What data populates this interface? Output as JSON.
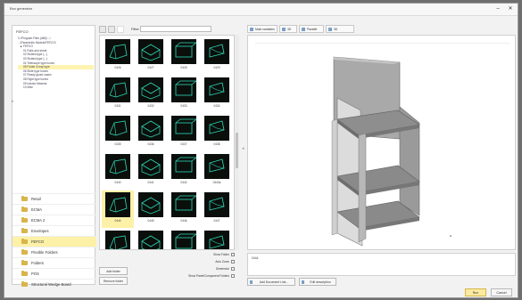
{
  "window": {
    "title": "Box generator",
    "min_glyph": "–",
    "close_glyph": "✕"
  },
  "tree": {
    "header": "FEFCO",
    "path_line1": "C:\\Program Files (x86)\\...\\",
    "path_line2": "...\\Parametric Models\\FEFCO\\",
    "nodes": [
      {
        "label": "▲ FEFCO",
        "selected": false
      },
      {
        "label": "01 Rolls and sheet",
        "selected": false
      },
      {
        "label": "02 Slotted-type (...)",
        "selected": false
      },
      {
        "label": "03 Slotted-type (...)",
        "selected": false
      },
      {
        "label": "04 Telescope type boxes",
        "selected": false
      },
      {
        "label": "05 Folder & tray type",
        "selected": true
      },
      {
        "label": "06 Slide type boxes",
        "selected": false
      },
      {
        "label": "07 Ready glued cases",
        "selected": false
      },
      {
        "label": "08 Rigid type boxes",
        "selected": false
      },
      {
        "label": "09 Interior fitments",
        "selected": false
      },
      {
        "label": "10 Misc",
        "selected": false
      }
    ]
  },
  "folders": [
    {
      "label": "Retail",
      "selected": false
    },
    {
      "label": "ECMA",
      "selected": false
    },
    {
      "label": "ECMA 2",
      "selected": false
    },
    {
      "label": "Envelopes",
      "selected": false
    },
    {
      "label": "FEFCO",
      "selected": true
    },
    {
      "label": "Flexible Folders",
      "selected": false
    },
    {
      "label": "Folders",
      "selected": false
    },
    {
      "label": "POS",
      "selected": false
    },
    {
      "label": "Structural Wedge Board",
      "selected": false
    }
  ],
  "toolbar": {
    "filter_label": "Filter"
  },
  "thumbnails": [
    "0426",
    "0427",
    "0428",
    "0429",
    "0431",
    "0432",
    "0433",
    "0434",
    "0435",
    "0436",
    "0437",
    "0438",
    "0440",
    "0441",
    "0442",
    "0443a",
    "0444",
    "0445",
    "0446",
    "0447",
    "0448",
    "0449",
    "0450",
    "0451"
  ],
  "selected_thumbnail": "0444",
  "mid_buttons": {
    "add": "Add folder",
    "remove": "Remove folder"
  },
  "options": [
    {
      "label": "Show Folder"
    },
    {
      "label": "Auto Zoom"
    },
    {
      "label": "Dimension"
    },
    {
      "label": "Show Panel/Component Folders"
    }
  ],
  "tabs": [
    {
      "label": "Main variables"
    },
    {
      "label": "3D"
    },
    {
      "label": "Parallel"
    },
    {
      "label": "3D Dimensions"
    }
  ],
  "viewer": {
    "name_value": "0444"
  },
  "right_buttons": {
    "add_doc": "Add Document Link...",
    "edit_desc": "Edit description"
  },
  "footer": {
    "run": "Run",
    "cancel": "Cancel"
  },
  "colors": {
    "selection": "#fdf1a7",
    "folder": "#d9b44a",
    "thumb_bg": "#0a0f0c",
    "thumb_line": "#2fd9b5"
  }
}
